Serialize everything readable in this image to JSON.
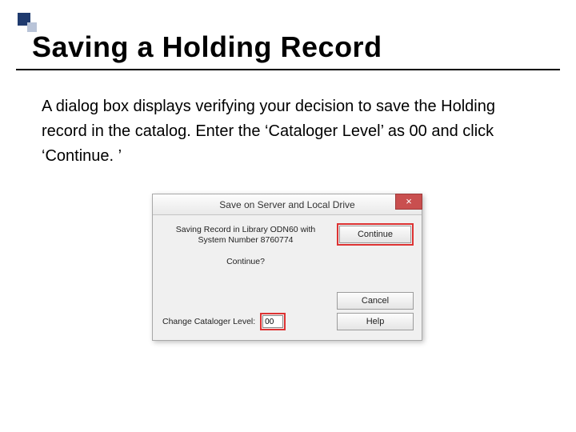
{
  "decoration": {
    "name": "corner-squares"
  },
  "title": "Saving a Holding Record",
  "body_text": "A dialog box displays verifying your decision to save the Holding record in the catalog.  Enter the ‘Cataloger Level’ as 00 and click ‘Continue. ’",
  "dialog": {
    "titlebar": "Save on Server and Local Drive",
    "close_glyph": "×",
    "message_line1": "Saving Record in Library ODN60 with",
    "message_line2": "System Number 8760774",
    "confirm_prompt": "Continue?",
    "level_label": "Change Cataloger Level:",
    "level_value": "00",
    "buttons": {
      "continue": "Continue",
      "cancel": "Cancel",
      "help": "Help"
    },
    "highlights": [
      "continue-button",
      "cataloger-level-input"
    ]
  }
}
